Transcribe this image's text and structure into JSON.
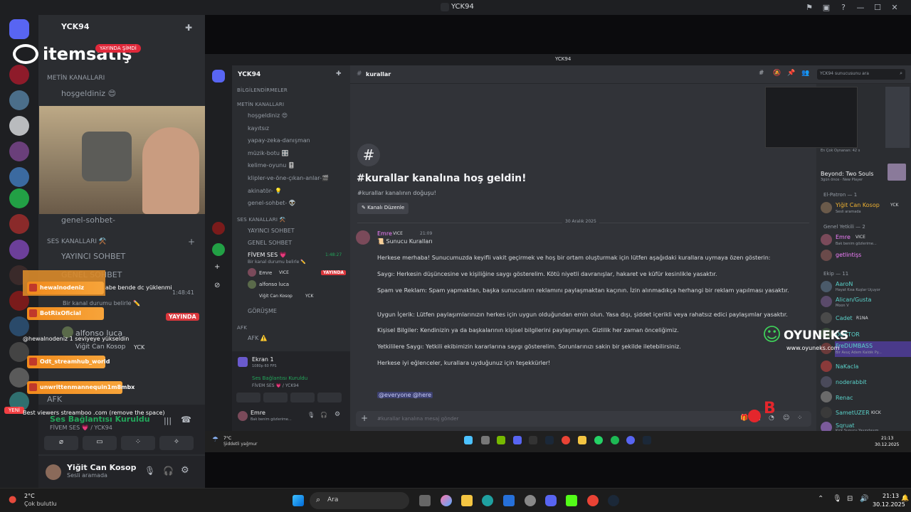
{
  "window": {
    "title": "YCK94"
  },
  "outer_sidebar": {
    "server_name": "YCK94",
    "category_text": "METİN KANALLARI",
    "channel_hosgeldiniz": "hoşgeldiniz 😍",
    "channel_genel_sohbet": "genel-sohbet-",
    "voice_category": "SES KANALLARI ⚒️",
    "voice_yayinci": "YAYINCI SOHBET",
    "voice_genel": "GENEL SOHBET",
    "stream_time": "1:48:41",
    "status_line": "Bir kanal durumu belirle ✏️",
    "live_badge": "YAYINDA",
    "member_alfonso": "alfonso luca",
    "member_yigit": "Viğit Can Kosop",
    "member_yigit_tag": "YCK",
    "afk": "AFK",
    "voice_connected": "Ses Bağlantısı Kuruldu",
    "voice_channel_path": "FİVEM SES 💗 / YCK94",
    "user_name": "Yiğit Can Kosop",
    "user_status": "Sesli aramada"
  },
  "overlay": {
    "logo_text": "itemsatış",
    "logo_tag": "YAYINDA ŞİMDİ",
    "ad_text": "Best viewers streamboo .com (remove the space)",
    "alert_text": "abe bende dc yüklenmi",
    "alert_sub": "@hewalnodeniz 1 seviyeye yükseldin",
    "tags": [
      "hewalnodeniz",
      "BotRixOficial",
      "Odt_streamhub_world",
      "unwrittenmannequin1m8mbx"
    ],
    "new_badge": "YENİ"
  },
  "inner": {
    "title": "YCK94",
    "server_name": "YCK94",
    "categories": {
      "info": "BİLGİLENDİRMELER",
      "text": "METİN KANALLARI",
      "voice": "SES KANALLARI ⚒️",
      "afk": "AFK"
    },
    "channels": [
      "hoşgeldiniz 😍",
      "kayıtsız",
      "yapay-zeka-danışman",
      "müzik-botu 🎛️",
      "kelime-oyunu 🎚️",
      "klipler-ve-öne-çıkan-anlar-🎬",
      "akinatör- 💡",
      "genel-sohbet- 👽"
    ],
    "voice_channels": {
      "yayinci": "YAYINCI SOHBET",
      "genel": "GENEL SOHBET",
      "fivem": "FİVEM SES 💗",
      "fivem_time": "1:48:27",
      "fivem_status": "Bir kanal durumu belirle ✏️",
      "gorusme": "GÖRÜŞME",
      "afk": "AFK ⚠️"
    },
    "voice_members": [
      {
        "name": "Emre",
        "tag": "VICE",
        "badge": "YAYINDA"
      },
      {
        "name": "alfonso luca",
        "tag": "",
        "badge": ""
      },
      {
        "name": "Viğit Can Kosop",
        "tag": "YCK",
        "badge": ""
      }
    ],
    "screen_panel": {
      "title": "Ekran 1",
      "sub": "1080p 60 FPS"
    },
    "voice_panel": {
      "status": "Ses Bağlantısı Kuruldu",
      "path": "FİVEM SES 💗 / YCK94"
    },
    "user_panel": {
      "name": "Emre",
      "status": "Bak benim gözlerime..."
    },
    "header": {
      "channel": "kurallar",
      "search_placeholder": "YCK94 sunucusunu ara"
    },
    "welcome": {
      "title": "#kurallar kanalına hoş geldin!",
      "subtitle": "#kurallar kanalının doğuşu!",
      "edit_button": "Kanalı Düzenle"
    },
    "date_divider": "30 Aralık 2025",
    "message": {
      "author": "Emre",
      "author_tag": "VICE",
      "time": "21:09",
      "lines": [
        "📜 Sunucu Kuralları",
        "Herkese merhaba! Sunucumuzda keyifli vakit geçirmek ve hoş bir ortam oluşturmak için lütfen aşağıdaki kurallara uymaya özen gösterin:",
        "Saygı: Herkesin düşüncesine ve kişiliğine saygı gösterelim. Kötü niyetli davranışlar, hakaret ve küfür kesinlikle yasaktır.",
        "Spam ve Reklam: Spam yapmaktan, başka sunucuların reklamını paylaşmaktan kaçının. İzin alınmadıkça herhangi bir reklam yapılması yasaktır.",
        "Uygun İçerik: Lütfen paylaşımlarınızın herkes için uygun olduğundan emin olun. Yasa dışı, şiddet içerikli veya rahatsız edici paylaşımlar yasaktır.",
        "Kişisel Bilgiler: Kendinizin ya da başkalarının kişisel bilgilerini paylaşmayın. Gizlilik her zaman önceliğimiz.",
        "Yetkililere Saygı: Yetkili ekibimizin kararlarına saygı gösterelim. Sorunlarınızı sakin bir şekilde iletebilirsiniz.",
        "Herkese iyi eğlenceler, kurallara uyduğunuz için teşekkürler!"
      ],
      "mentions": "@everyone @here"
    },
    "composer_placeholder": "#kurallar kanalına mesaj gönder",
    "members": {
      "activity_label": "En Çok Oynanan: 42 s",
      "game_title": "Beyond: Two Souls",
      "game_sub": "3gün önce · New Player",
      "cat1": "El-Patron — 1",
      "m1": "Yiğit Can Kosop",
      "m1_tag": "YCK",
      "m1_status": "Sesli aramada",
      "cat2": "Genel Yetkili — 2",
      "m2": "Emre",
      "m2_tag": "VICE",
      "m2_status": "Bak benim gözlerime...",
      "m3": "getlintişs",
      "cat3": "Ekip — 11",
      "m4": "AaroN",
      "m4_status": "Hayat Kısa Kuşlar Uçuyor",
      "m5": "Alican/Gusta",
      "m5_status": "Moon V",
      "m6": "Cadet",
      "m6_tag": "R1NA",
      "m7": "DOKTOR",
      "m8": "FreDUMBASS",
      "m8_status": "Bir Avuç Adem Kaldık Py...",
      "m9": "NaKacla",
      "m10": "noderabbit",
      "m11": "Renac",
      "m12": "SametUZER",
      "m12_tag": "KICK",
      "m13": "Sqruat",
      "m13_status": "Kick Sunucu Yayındayım"
    },
    "watermark": {
      "brand": "OYUNEKS",
      "url": "www.oyuneks.com"
    },
    "taskbar": {
      "weather_temp": "7°C",
      "weather_desc": "Şiddetli yağmur",
      "time": "21:13",
      "date": "30.12.2025"
    }
  },
  "taskbar": {
    "weather_temp": "2°C",
    "weather_desc": "Çok bulutlu",
    "search_placeholder": "Ara",
    "time": "21:13",
    "date": "30.12.2025"
  }
}
